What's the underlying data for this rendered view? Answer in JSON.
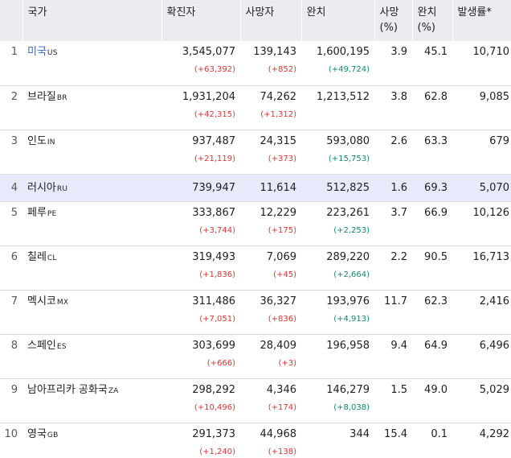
{
  "headers": {
    "country": "국가",
    "confirmed": "확진자",
    "deaths": "사망자",
    "recovered": "완치",
    "death_rate": "사망\n(%)",
    "recovery_rate": "완치\n(%)",
    "incidence": "발생률*"
  },
  "rows": [
    {
      "rank": "1",
      "name": "미국",
      "code": "US",
      "confirmed": "3,545,077",
      "confirmed_delta": "(+63,392)",
      "deaths": "139,143",
      "deaths_delta": "(+852)",
      "recovered": "1,600,195",
      "recovered_delta": "(+49,724)",
      "death_rate": "3.9",
      "recovery_rate": "45.1",
      "incidence": "10,710"
    },
    {
      "rank": "2",
      "name": "브라질",
      "code": "BR",
      "confirmed": "1,931,204",
      "confirmed_delta": "(+42,315)",
      "deaths": "74,262",
      "deaths_delta": "(+1,312)",
      "recovered": "1,213,512",
      "recovered_delta": "",
      "death_rate": "3.8",
      "recovery_rate": "62.8",
      "incidence": "9,085"
    },
    {
      "rank": "3",
      "name": "인도",
      "code": "IN",
      "confirmed": "937,487",
      "confirmed_delta": "(+21,119)",
      "deaths": "24,315",
      "deaths_delta": "(+373)",
      "recovered": "593,080",
      "recovered_delta": "(+15,753)",
      "death_rate": "2.6",
      "recovery_rate": "63.3",
      "incidence": "679"
    },
    {
      "rank": "4",
      "name": "러시아",
      "code": "RU",
      "confirmed": "739,947",
      "confirmed_delta": "",
      "deaths": "11,614",
      "deaths_delta": "",
      "recovered": "512,825",
      "recovered_delta": "",
      "death_rate": "1.6",
      "recovery_rate": "69.3",
      "incidence": "5,070"
    },
    {
      "rank": "5",
      "name": "페루",
      "code": "PE",
      "confirmed": "333,867",
      "confirmed_delta": "(+3,744)",
      "deaths": "12,229",
      "deaths_delta": "(+175)",
      "recovered": "223,261",
      "recovered_delta": "(+2,253)",
      "death_rate": "3.7",
      "recovery_rate": "66.9",
      "incidence": "10,126"
    },
    {
      "rank": "6",
      "name": "칠레",
      "code": "CL",
      "confirmed": "319,493",
      "confirmed_delta": "(+1,836)",
      "deaths": "7,069",
      "deaths_delta": "(+45)",
      "recovered": "289,220",
      "recovered_delta": "(+2,664)",
      "death_rate": "2.2",
      "recovery_rate": "90.5",
      "incidence": "16,713"
    },
    {
      "rank": "7",
      "name": "멕시코",
      "code": "MX",
      "confirmed": "311,486",
      "confirmed_delta": "(+7,051)",
      "deaths": "36,327",
      "deaths_delta": "(+836)",
      "recovered": "193,976",
      "recovered_delta": "(+4,913)",
      "death_rate": "11.7",
      "recovery_rate": "62.3",
      "incidence": "2,416"
    },
    {
      "rank": "8",
      "name": "스페인",
      "code": "ES",
      "confirmed": "303,699",
      "confirmed_delta": "(+666)",
      "deaths": "28,409",
      "deaths_delta": "(+3)",
      "recovered": "196,958",
      "recovered_delta": "",
      "death_rate": "9.4",
      "recovery_rate": "64.9",
      "incidence": "6,496"
    },
    {
      "rank": "9",
      "name": "남아프리카 공화국",
      "code": "ZA",
      "confirmed": "298,292",
      "confirmed_delta": "(+10,496)",
      "deaths": "4,346",
      "deaths_delta": "(+174)",
      "recovered": "146,279",
      "recovered_delta": "(+8,038)",
      "death_rate": "1.5",
      "recovery_rate": "49.0",
      "incidence": "5,029"
    },
    {
      "rank": "10",
      "name": "영국",
      "code": "GB",
      "confirmed": "291,373",
      "confirmed_delta": "(+1,240)",
      "deaths": "44,968",
      "deaths_delta": "(+138)",
      "recovered": "344",
      "recovered_delta": "",
      "death_rate": "15.4",
      "recovery_rate": "0.1",
      "incidence": "4,292"
    }
  ],
  "colors": {
    "header_bg": "#eaecf0",
    "highlight_row_bg": "#e8e9fa",
    "link": "#3366cc",
    "increase": "#dd3333",
    "recovered_increase": "#14866d"
  }
}
